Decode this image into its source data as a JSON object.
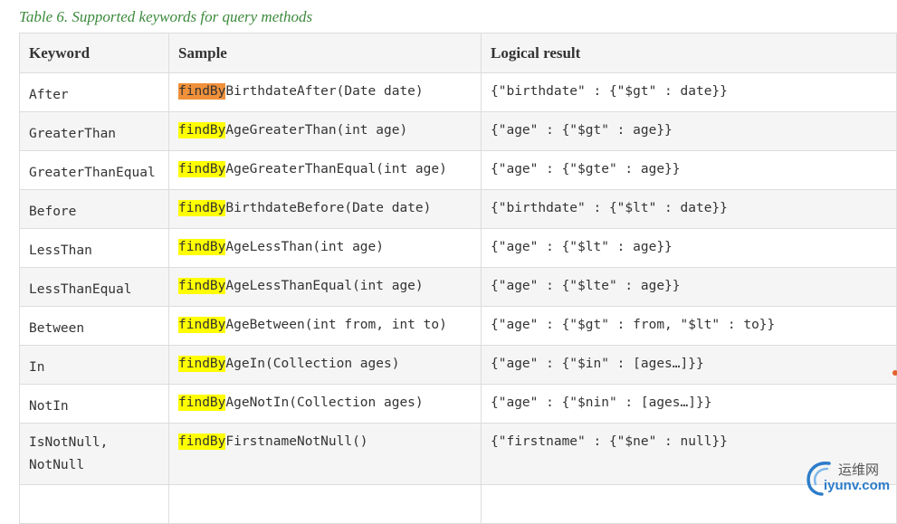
{
  "caption": "Table 6. Supported keywords for query methods",
  "headers": {
    "keyword": "Keyword",
    "sample": "Sample",
    "result": "Logical result"
  },
  "rows": [
    {
      "keyword": "After",
      "prefix": "findBy",
      "method": "BirthdateAfter(Date date)",
      "result": "{\"birthdate\" : {\"$gt\" : date}}"
    },
    {
      "keyword": "GreaterThan",
      "prefix": "findBy",
      "method": "AgeGreaterThan(int age)",
      "result": "{\"age\" : {\"$gt\" : age}}"
    },
    {
      "keyword": "GreaterThanEqual",
      "prefix": "findBy",
      "method": "AgeGreaterThanEqual(int age)",
      "result": "{\"age\" : {\"$gte\" : age}}"
    },
    {
      "keyword": "Before",
      "prefix": "findBy",
      "method": "BirthdateBefore(Date date)",
      "result": "{\"birthdate\" : {\"$lt\" : date}}"
    },
    {
      "keyword": "LessThan",
      "prefix": "findBy",
      "method": "AgeLessThan(int age)",
      "result": "{\"age\" : {\"$lt\" : age}}"
    },
    {
      "keyword": "LessThanEqual",
      "prefix": "findBy",
      "method": "AgeLessThanEqual(int age)",
      "result": "{\"age\" : {\"$lte\" : age}}"
    },
    {
      "keyword": "Between",
      "prefix": "findBy",
      "method": "AgeBetween(int from, int to)",
      "result": "{\"age\" : {\"$gt\" : from, \"$lt\" : to}}"
    },
    {
      "keyword": "In",
      "prefix": "findBy",
      "method": "AgeIn(Collection ages)",
      "result": "{\"age\" : {\"$in\" : [ages…]}}"
    },
    {
      "keyword": "NotIn",
      "prefix": "findBy",
      "method": "AgeNotIn(Collection ages)",
      "result": "{\"age\" : {\"$nin\" : [ages…]}}"
    },
    {
      "keyword": " IsNotNull,\n NotNull",
      "prefix": "findBy",
      "method": "FirstnameNotNull()",
      "result": "{\"firstname\" : {\"$ne\" : null}}"
    }
  ],
  "watermark": {
    "cn": "运维网",
    "url": "iyunv.com"
  },
  "colors": {
    "caption": "#3c8a3c",
    "highlight": "#ffff00",
    "highlight_active": "#f0903a",
    "border": "#dddddd",
    "stripe": "#f5f5f5"
  }
}
